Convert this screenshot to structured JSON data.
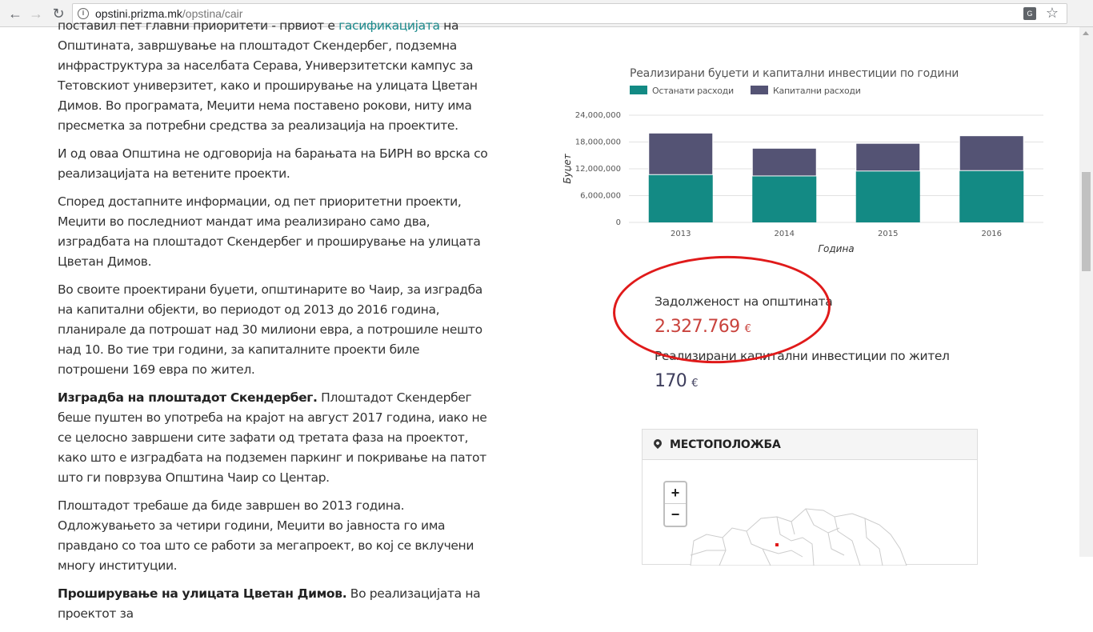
{
  "browser": {
    "url_host": "opstini.prizma.mk",
    "url_path": "/opstina/cair"
  },
  "article": {
    "p1_before_link": "поставил пет главни приоритети - првиот е ",
    "p1_link": "гасификацијата",
    "p1_after_link": " на Општината, завршување на плоштадот Скендербег, подземна инфраструктура за населбата Серава, Универзитетски кампус за Тетовскиот универзитет, како и проширување на улицата Цветан Димов. Во програмата, Меџити нема поставено рокови, ниту има пресметка за потребни средства за реализација на проектите.",
    "p2": "И од оваа Општина не одговорија на барањата на БИРН во врска со реализацијата на ветените проекти.",
    "p3": "Според достапните информации, од пет приоритетни проекти, Меџити во последниот мандат има реализирано само два, изградбата на плоштадот Скендербег и проширување на улицата Цветан Димов.",
    "p4": "Во своите проектирани буџети, општинарите во Чаир, за изградба на капитални објекти, во периодот од 2013 до 2016 година, планирале да потрошат над 30 милиони евра, а потрошиле нешто над 10. Во тие три години, за капиталните проекти биле потрошени 169 евра по жител.",
    "p5_bold": "Изградба на плоштадот Скендербег.",
    "p5_rest": " Плоштадот Скендербег беше пуштен во употреба на крајот на август 2017 година, иако не се целосно завршени сите зафати од третата фаза на проектот, како што е изградбата на подземен паркинг и покривање на патот што ги поврзува Општина Чаир со Центар.",
    "p6": "Плоштадот требаше да биде завршен во 2013 година. Одложувањето за четири години, Меџити во јавноста го има правдано со тоа што се работи за мегапроект, во кој се вклучени многу институции.",
    "p7_bold": "Проширување на улицата Цветан Димов.",
    "p7_rest": " Во реализацијата на проектот за"
  },
  "chart_data": {
    "type": "bar",
    "stacked": true,
    "title": "Реализирани буџети и капитални инвестиции по години",
    "xlabel": "Година",
    "ylabel": "Буџет",
    "categories": [
      "2013",
      "2014",
      "2015",
      "2016"
    ],
    "ylim": [
      0,
      24000000
    ],
    "yticks": [
      "0",
      "6,000,000",
      "12,000,000",
      "18,000,000",
      "24,000,000"
    ],
    "ytick_values": [
      0,
      6000000,
      12000000,
      18000000,
      24000000
    ],
    "legend_position": "top-left",
    "grid": true,
    "series": [
      {
        "name": "Останати расходи",
        "color": "#138a84",
        "values": [
          10700000,
          10400000,
          11500000,
          11600000
        ]
      },
      {
        "name": "Капитални расходи",
        "color": "#545374",
        "values": [
          9300000,
          6200000,
          6200000,
          7800000
        ]
      }
    ]
  },
  "stats": {
    "debt_label": "Задолженост на општината",
    "debt_value": "2.327.769",
    "debt_currency": "€",
    "debt_color": "#c9433d",
    "capex_label": "Реализирани капитални инвестиции по жител",
    "capex_value": "170",
    "capex_currency": "€",
    "capex_color": "#3d3d5c"
  },
  "location": {
    "heading": "МЕСТОПОЛОЖБА",
    "zoom_in": "+",
    "zoom_out": "−"
  }
}
